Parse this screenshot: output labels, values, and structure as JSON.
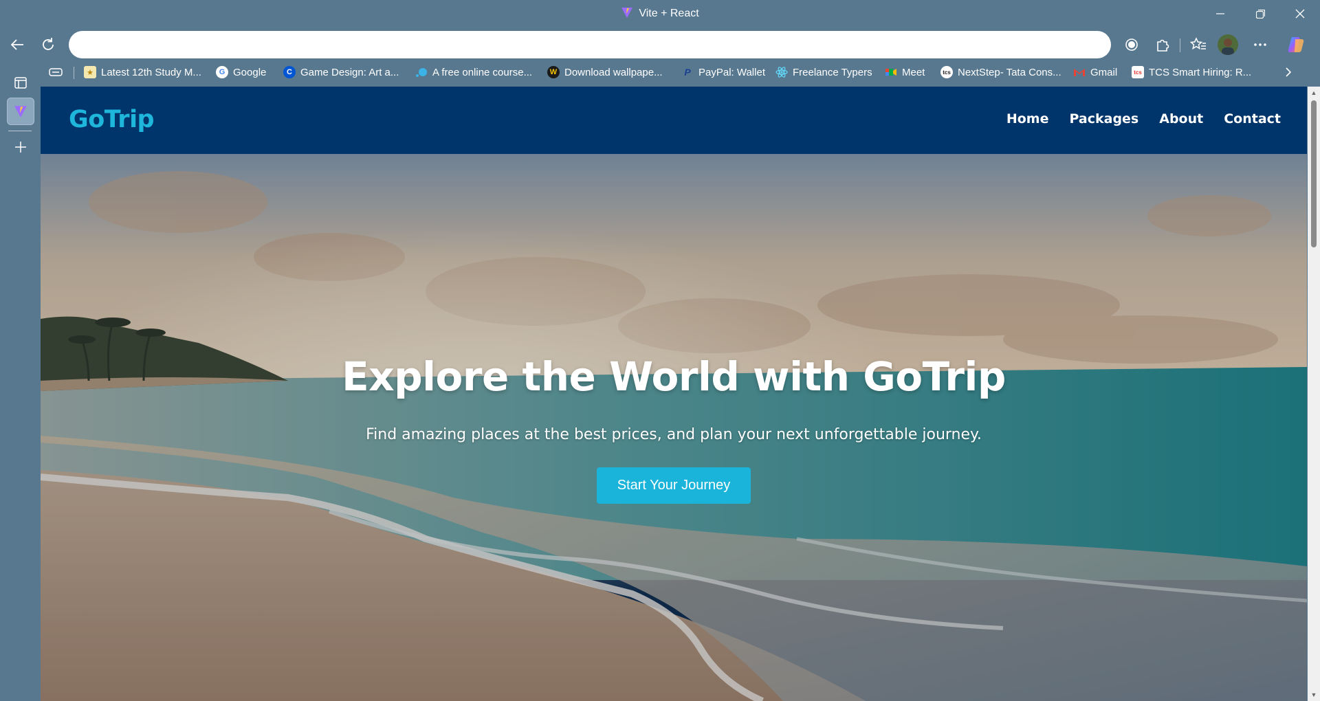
{
  "window": {
    "title": "Vite + React",
    "controls": [
      "minimize-icon",
      "restore-icon",
      "close-icon"
    ]
  },
  "toolbar": {
    "address_value": "",
    "address_placeholder": "",
    "icons": [
      "back-arrow-icon",
      "reload-icon",
      "record-icon",
      "extensions-icon",
      "favorites-icon",
      "profile-avatar",
      "more-icon",
      "copilot-icon"
    ]
  },
  "bookmarks": [
    {
      "label": "Latest 12th Study M...",
      "icon": "study-icon",
      "color": "#e6c64a"
    },
    {
      "label": "Google",
      "icon": "google-icon",
      "color": "#ffffff"
    },
    {
      "label": "Game Design: Art a...",
      "icon": "coursera-icon",
      "color": "#0056d2"
    },
    {
      "label": "A free online course...",
      "icon": "course-icon",
      "color": "#3bb3e6"
    },
    {
      "label": "Download wallpape...",
      "icon": "wallpaper-icon",
      "color": "#1a1a1a"
    },
    {
      "label": "PayPal: Wallet",
      "icon": "paypal-icon",
      "color": "#ffffff"
    },
    {
      "label": "Freelance Typers",
      "icon": "react-icon",
      "color": "#61dafb"
    },
    {
      "label": "Meet",
      "icon": "meet-icon",
      "color": "#00ac47"
    },
    {
      "label": "NextStep- Tata Cons...",
      "icon": "tcs-icon",
      "color": "#ffffff"
    },
    {
      "label": "Gmail",
      "icon": "gmail-icon",
      "color": "#ea4335"
    },
    {
      "label": "TCS Smart Hiring: R...",
      "icon": "tcs-red-icon",
      "color": "#e53935"
    }
  ],
  "site": {
    "logo": "GoTrip",
    "nav": [
      "Home",
      "Packages",
      "About",
      "Contact"
    ],
    "hero_title": "Explore the World with GoTrip",
    "hero_subtitle": "Find amazing places at the best prices, and plan your next unforgettable journey.",
    "cta_label": "Start Your Journey",
    "colors": {
      "nav_bg": "#00356b",
      "logo": "#1fb6dc",
      "cta_bg": "#1ab3d9"
    }
  }
}
